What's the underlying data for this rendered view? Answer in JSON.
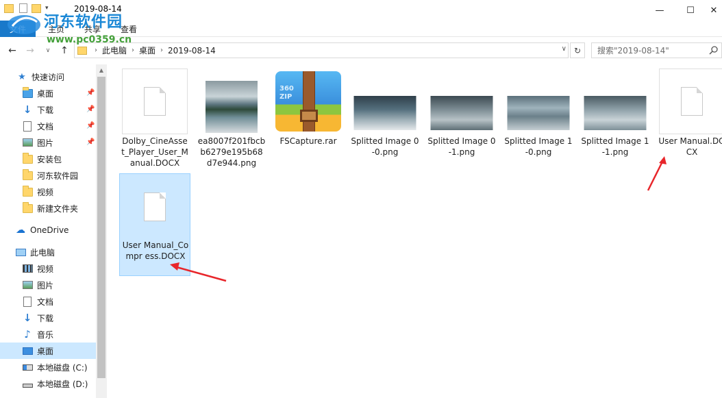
{
  "window": {
    "title": "2019-08-14",
    "controls": {
      "minimize": "—",
      "maximize": "☐",
      "close": "✕"
    }
  },
  "ribbon": {
    "tabs": [
      "文件",
      "主页",
      "共享",
      "查看"
    ]
  },
  "address": {
    "crumbs": [
      "此电脑",
      "桌面",
      "2019-08-14"
    ],
    "search_placeholder": "搜索\"2019-08-14\""
  },
  "sidebar": {
    "quick_access": "快速访问",
    "quick_items": [
      {
        "label": "桌面",
        "icon": "folder-blue-icon",
        "pinned": true
      },
      {
        "label": "下载",
        "icon": "download-arrow-icon",
        "pinned": true
      },
      {
        "label": "文档",
        "icon": "document-icon",
        "pinned": true
      },
      {
        "label": "图片",
        "icon": "picture-icon",
        "pinned": true
      },
      {
        "label": "安装包",
        "icon": "folder-icon",
        "pinned": false
      },
      {
        "label": "河东软件园",
        "icon": "folder-icon",
        "pinned": false
      },
      {
        "label": "视频",
        "icon": "folder-icon",
        "pinned": false
      },
      {
        "label": "新建文件夹",
        "icon": "folder-icon",
        "pinned": false
      }
    ],
    "onedrive": "OneDrive",
    "this_pc": "此电脑",
    "pc_items": [
      {
        "label": "视频",
        "icon": "video-icon"
      },
      {
        "label": "图片",
        "icon": "picture-icon"
      },
      {
        "label": "文档",
        "icon": "document-icon"
      },
      {
        "label": "下载",
        "icon": "download-arrow-icon"
      },
      {
        "label": "音乐",
        "icon": "music-note-icon"
      },
      {
        "label": "桌面",
        "icon": "desktop-icon",
        "selected": true
      },
      {
        "label": "本地磁盘 (C:)",
        "icon": "system-drive-icon"
      },
      {
        "label": "本地磁盘 (D:)",
        "icon": "drive-icon"
      }
    ]
  },
  "files": [
    {
      "name": "Dolby_CineAsset_Player_User_Manual.DOCX",
      "display": "Dolby_CineAsse t_Player_User_M anual.DOCX",
      "type": "docx"
    },
    {
      "name": "ea8007f201fbcbb6279e195b68d7e944.png",
      "display": "ea8007f201fbcb b6279e195b68 d7e944.png",
      "type": "photo"
    },
    {
      "name": "FSCapture.rar",
      "display": "FSCapture.rar",
      "type": "rar",
      "badge": "360 ZIP"
    },
    {
      "name": "Splitted Image 0-0.png",
      "display": "Splitted Image 0-0.png",
      "type": "photo"
    },
    {
      "name": "Splitted Image 0-1.png",
      "display": "Splitted Image 0-1.png",
      "type": "photo"
    },
    {
      "name": "Splitted Image 1-0.png",
      "display": "Splitted Image 1-0.png",
      "type": "photo"
    },
    {
      "name": "Splitted Image 1-1.png",
      "display": "Splitted Image 1-1.png",
      "type": "photo"
    },
    {
      "name": "User Manual.DOCX",
      "display": "User Manual.DOCX",
      "type": "docx"
    },
    {
      "name": "User Manual_Compress.DOCX",
      "display": "User Manual_Compr ess.DOCX",
      "type": "docx",
      "selected": true
    }
  ],
  "watermark": {
    "title": "河东软件园",
    "url": "www.pc0359.cn"
  },
  "colors": {
    "selection": "#cce8ff",
    "accent": "#1979ca",
    "arrow": "#e8262b"
  }
}
